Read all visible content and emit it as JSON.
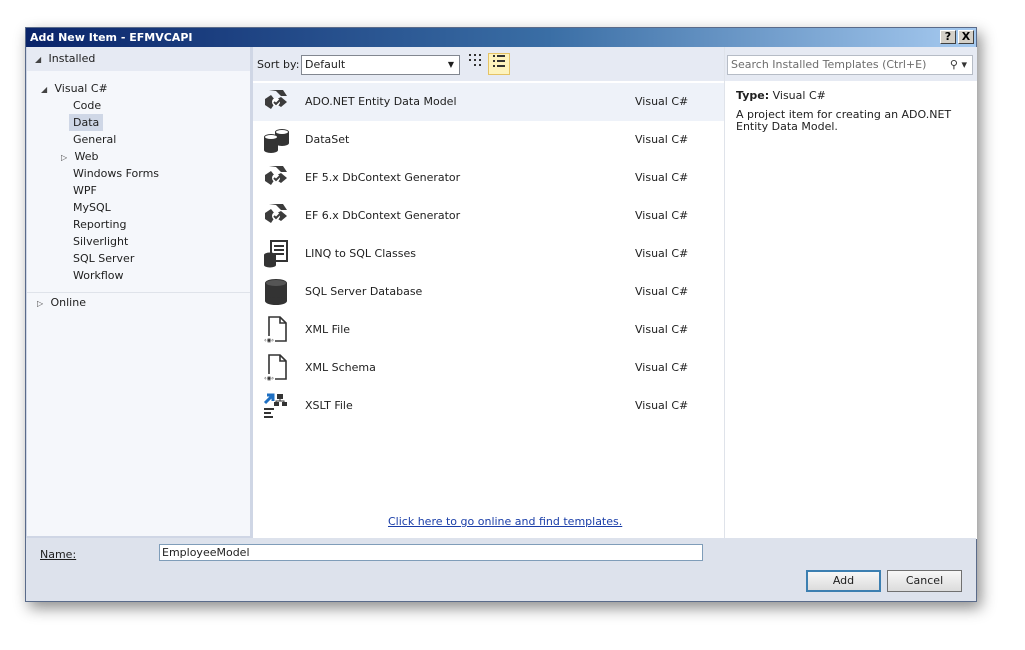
{
  "window": {
    "title": "Add New Item - EFMVCAPI",
    "help_button": "?",
    "close_button": "X"
  },
  "sidebar": {
    "header": "Installed",
    "tree": {
      "root": "Visual C#",
      "children": [
        "Code",
        "Data",
        "General",
        "Web",
        "Windows Forms",
        "WPF",
        "MySQL",
        "Reporting",
        "Silverlight",
        "SQL Server",
        "Workflow"
      ],
      "selected": "Data",
      "online": "Online"
    }
  },
  "toolbar": {
    "sort_label": "Sort by:",
    "sort_value": "Default"
  },
  "items": [
    {
      "name": "ADO.NET Entity Data Model",
      "lang": "Visual C#",
      "icon": "entity-model-icon"
    },
    {
      "name": "DataSet",
      "lang": "Visual C#",
      "icon": "dataset-icon"
    },
    {
      "name": "EF 5.x DbContext Generator",
      "lang": "Visual C#",
      "icon": "dbcontext-generator-icon"
    },
    {
      "name": "EF 6.x DbContext Generator",
      "lang": "Visual C#",
      "icon": "dbcontext-generator-icon"
    },
    {
      "name": "LINQ to SQL Classes",
      "lang": "Visual C#",
      "icon": "linq-to-sql-icon"
    },
    {
      "name": "SQL Server Database",
      "lang": "Visual C#",
      "icon": "database-icon"
    },
    {
      "name": "XML File",
      "lang": "Visual C#",
      "icon": "xml-file-icon"
    },
    {
      "name": "XML Schema",
      "lang": "Visual C#",
      "icon": "xml-schema-icon"
    },
    {
      "name": "XSLT File",
      "lang": "Visual C#",
      "icon": "xslt-file-icon"
    }
  ],
  "online_link": "Click here to go online and find templates.",
  "search": {
    "placeholder": "Search Installed Templates (Ctrl+E)"
  },
  "details": {
    "type_label": "Type:",
    "type_value": "Visual C#",
    "description": "A project item for creating an ADO.NET Entity Data Model."
  },
  "footer": {
    "name_label": "Name:",
    "name_value": "EmployeeModel",
    "add_label": "Add",
    "cancel_label": "Cancel"
  },
  "colors": {
    "title_gradient_start": "#0a246a",
    "link": "#1a3ea8",
    "selection": "#cfd7e6"
  }
}
